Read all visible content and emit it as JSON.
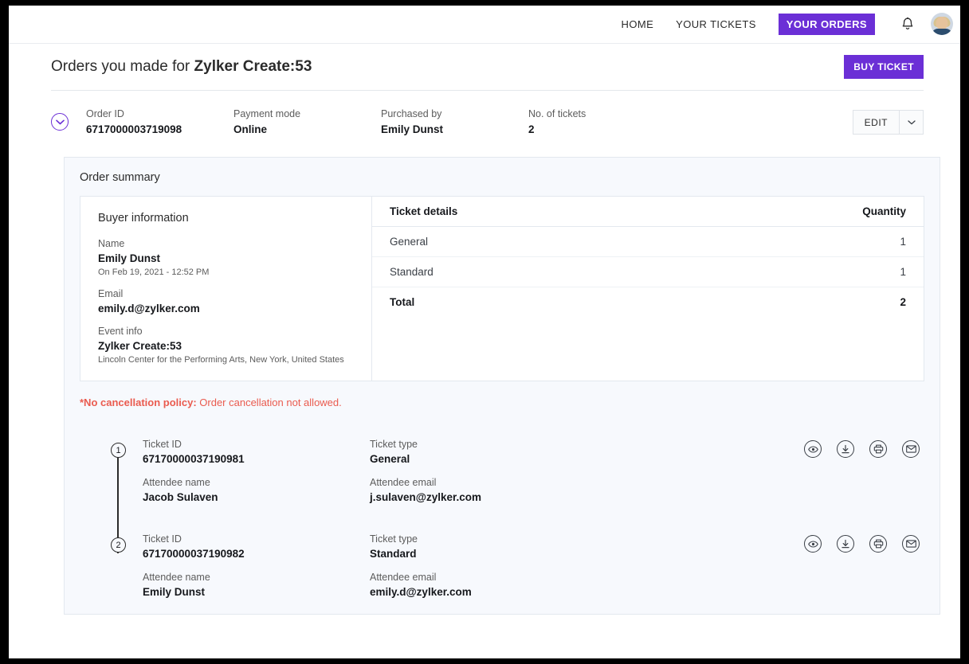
{
  "nav": {
    "links": [
      {
        "label": "HOME",
        "active": false
      },
      {
        "label": "YOUR TICKETS",
        "active": false
      },
      {
        "label": "YOUR ORDERS",
        "active": true
      }
    ],
    "bell_icon": "bell-icon",
    "avatar_icon": "user-avatar"
  },
  "header": {
    "title_prefix": "Orders you made for ",
    "event_name": "Zylker Create:53",
    "buy_ticket_label": "BUY TICKET"
  },
  "order": {
    "collapse_icon": "chevron-down-icon",
    "fields": [
      {
        "label": "Order ID",
        "value": "6717000003719098"
      },
      {
        "label": "Payment mode",
        "value": "Online"
      },
      {
        "label": "Purchased by",
        "value": "Emily Dunst"
      },
      {
        "label": "No. of tickets",
        "value": "2"
      }
    ],
    "edit_label": "EDIT",
    "edit_caret_icon": "chevron-down-icon"
  },
  "summary": {
    "title": "Order summary",
    "buyer": {
      "heading": "Buyer information",
      "name_label": "Name",
      "name_value": "Emily Dunst",
      "purchase_date": "On Feb 19, 2021 - 12:52 PM",
      "email_label": "Email",
      "email_value": "emily.d@zylker.com",
      "event_label": "Event info",
      "event_value": "Zylker Create:53",
      "venue": "Lincoln Center for the Performing Arts, New York, United States"
    },
    "table": {
      "col_details": "Ticket details",
      "col_quantity": "Quantity",
      "rows": [
        {
          "name": "General",
          "qty": "1"
        },
        {
          "name": "Standard",
          "qty": "1"
        }
      ],
      "total_label": "Total",
      "total_qty": "2"
    },
    "policy_bold": "*No cancellation policy:",
    "policy_text": " Order cancellation not allowed."
  },
  "tickets": {
    "labels": {
      "ticket_id": "Ticket ID",
      "ticket_type": "Ticket type",
      "attendee_name": "Attendee name",
      "attendee_email": "Attendee email"
    },
    "actions": [
      {
        "name": "view-ticket-icon"
      },
      {
        "name": "download-ticket-icon"
      },
      {
        "name": "print-ticket-icon"
      },
      {
        "name": "email-ticket-icon"
      }
    ],
    "items": [
      {
        "index": "1",
        "ticket_id": "67170000037190981",
        "ticket_type": "General",
        "attendee_name": "Jacob Sulaven",
        "attendee_email": "j.sulaven@zylker.com"
      },
      {
        "index": "2",
        "ticket_id": "67170000037190982",
        "ticket_type": "Standard",
        "attendee_name": "Emily Dunst",
        "attendee_email": "emily.d@zylker.com"
      }
    ]
  },
  "colors": {
    "accent_purple": "#6b2fd6",
    "policy_red": "#ea5b4f",
    "panel_bg": "#f7f9fd",
    "border": "#e3e8ef"
  }
}
